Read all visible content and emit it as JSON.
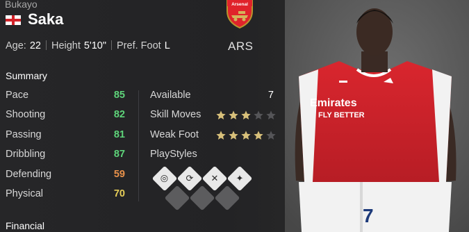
{
  "player": {
    "first_name": "Bukayo",
    "last_name": "Saka",
    "nation_flag": "england-flag-icon",
    "age_label": "Age:",
    "age": "22",
    "height_label": "Height",
    "height": "5'10\"",
    "foot_label": "Pref. Foot",
    "foot": "L"
  },
  "club": {
    "crest_text": "Arsenal",
    "code": "ARS",
    "crest_color": "#e0232b"
  },
  "summary": {
    "title": "Summary",
    "stats": [
      {
        "label": "Pace",
        "value": "85",
        "color": "#5ed47a"
      },
      {
        "label": "Shooting",
        "value": "82",
        "color": "#5ed47a"
      },
      {
        "label": "Passing",
        "value": "81",
        "color": "#5ed47a"
      },
      {
        "label": "Dribbling",
        "value": "87",
        "color": "#5ed47a"
      },
      {
        "label": "Defending",
        "value": "59",
        "color": "#e8914a"
      },
      {
        "label": "Physical",
        "value": "70",
        "color": "#e6cd58"
      }
    ]
  },
  "attributes": {
    "available_label": "Available",
    "available_value": "7",
    "skill_moves_label": "Skill Moves",
    "skill_moves_rating": 3,
    "weak_foot_label": "Weak Foot",
    "weak_foot_rating": 4,
    "max_stars": 5,
    "star_on_color": "#d8c07a",
    "star_off_color": "#555558",
    "playstyles_label": "PlayStyles",
    "playstyles": [
      "playstyle-finesse-shot-icon",
      "playstyle-whipped-pass-icon",
      "playstyle-trickster-icon",
      "playstyle-technical-icon"
    ],
    "empty_slots": 3
  },
  "financial": {
    "title": "Financial"
  }
}
